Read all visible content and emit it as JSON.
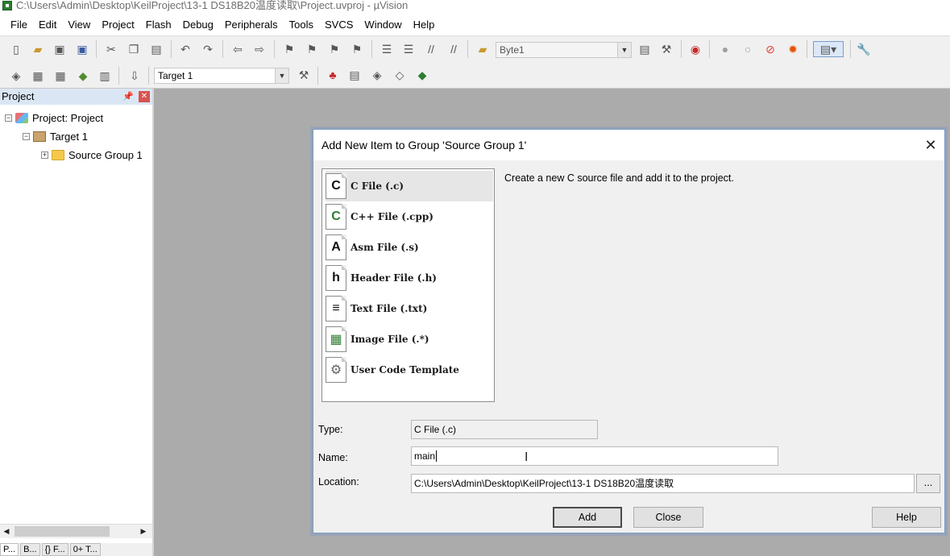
{
  "window": {
    "title": "C:\\Users\\Admin\\Desktop\\KeilProject\\13-1 DS18B20温度读取\\Project.uvproj - µVision"
  },
  "menu": [
    "File",
    "Edit",
    "View",
    "Project",
    "Flash",
    "Debug",
    "Peripherals",
    "Tools",
    "SVCS",
    "Window",
    "Help"
  ],
  "toolbar": {
    "find_combo": "Byte1",
    "target_combo": "Target 1"
  },
  "project_pane": {
    "title": "Project",
    "tree": {
      "project": "Project: Project",
      "target": "Target 1",
      "group": "Source Group 1"
    },
    "tabs": [
      "P...",
      "B...",
      "{} F...",
      "0+ T..."
    ]
  },
  "dialog": {
    "title": "Add New Item to Group 'Source Group 1'",
    "items": [
      {
        "label": "C File (.c)",
        "glyph": "C"
      },
      {
        "label": "C++ File (.cpp)",
        "glyph": "C"
      },
      {
        "label": "Asm File (.s)",
        "glyph": "A"
      },
      {
        "label": "Header File (.h)",
        "glyph": "h"
      },
      {
        "label": "Text File (.txt)",
        "glyph": "≡"
      },
      {
        "label": "Image File (.*)",
        "glyph": "▦"
      },
      {
        "label": "User Code Template",
        "glyph": "⚙"
      }
    ],
    "description": "Create a new C source file and add it to the project.",
    "type_label": "Type:",
    "type_value": "C File (.c)",
    "name_label": "Name:",
    "name_value": "main",
    "location_label": "Location:",
    "location_value": "C:\\Users\\Admin\\Desktop\\KeilProject\\13-1 DS18B20温度读取",
    "browse_label": "...",
    "add_label": "Add",
    "close_label": "Close",
    "help_label": "Help"
  },
  "colors": {
    "accent": "#7a9cc7",
    "pane_header": "#dbe6f4",
    "workspace": "#ababab"
  }
}
